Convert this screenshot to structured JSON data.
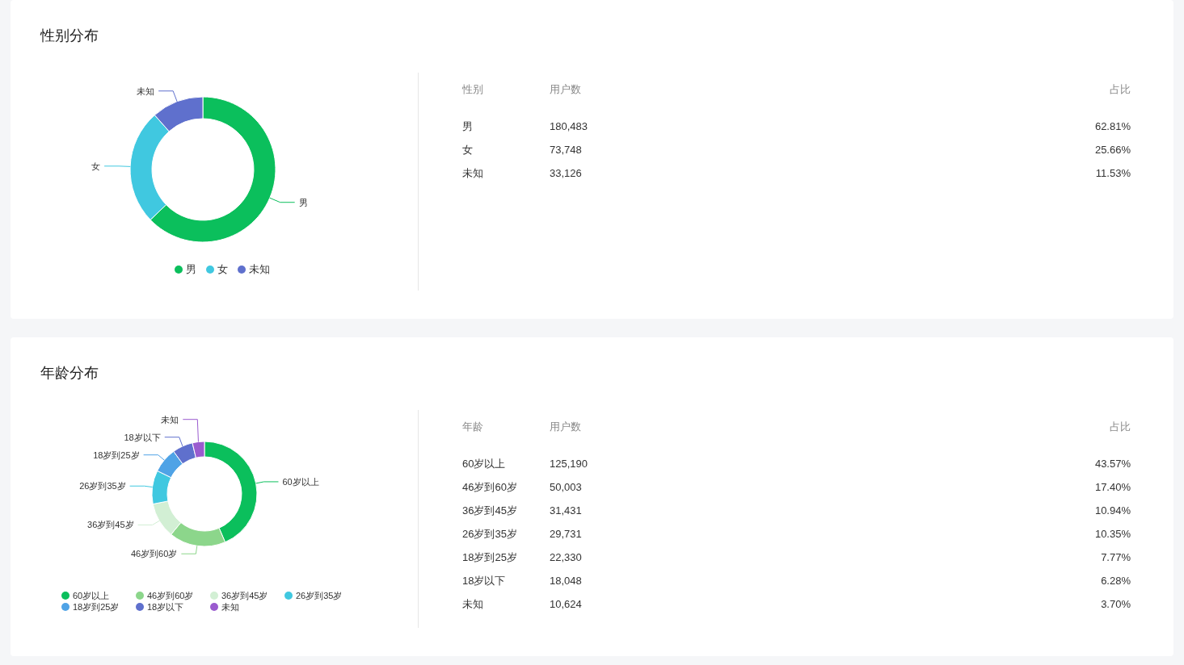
{
  "sections": [
    {
      "title": "性别分布",
      "chart": {
        "chart_data": {
          "type": "donut",
          "categories": [
            "男",
            "女",
            "未知"
          ],
          "values": [
            62.81,
            25.66,
            11.53
          ]
        },
        "legend": [
          {
            "label": "男",
            "color": "#0bbf5c"
          },
          {
            "label": "女",
            "color": "#40c8e0"
          },
          {
            "label": "未知",
            "color": "#5f70cd"
          }
        ]
      },
      "table": {
        "columns": [
          "性别",
          "用户数",
          "占比"
        ],
        "rows": [
          [
            "男",
            "180,483",
            "62.81%"
          ],
          [
            "女",
            "73,748",
            "25.66%"
          ],
          [
            "未知",
            "33,126",
            "11.53%"
          ]
        ]
      }
    },
    {
      "title": "年龄分布",
      "chart": {
        "chart_data": {
          "type": "donut",
          "categories": [
            "60岁以上",
            "46岁到60岁",
            "36岁到45岁",
            "26岁到35岁",
            "18岁到25岁",
            "18岁以下",
            "未知"
          ],
          "values": [
            43.57,
            17.4,
            10.94,
            10.35,
            7.77,
            6.28,
            3.7
          ]
        },
        "legend": [
          {
            "label": "60岁以上",
            "color": "#0bbf5c"
          },
          {
            "label": "46岁到60岁",
            "color": "#8cd68b"
          },
          {
            "label": "36岁到45岁",
            "color": "#d2efd4"
          },
          {
            "label": "26岁到35岁",
            "color": "#40c8e0"
          },
          {
            "label": "18岁到25岁",
            "color": "#4fa3e6"
          },
          {
            "label": "18岁以下",
            "color": "#5f70cd"
          },
          {
            "label": "未知",
            "color": "#9a5bcf"
          }
        ]
      },
      "table": {
        "columns": [
          "年龄",
          "用户数",
          "占比"
        ],
        "rows": [
          [
            "60岁以上",
            "125,190",
            "43.57%"
          ],
          [
            "46岁到60岁",
            "50,003",
            "17.40%"
          ],
          [
            "36岁到45岁",
            "31,431",
            "10.94%"
          ],
          [
            "26岁到35岁",
            "29,731",
            "10.35%"
          ],
          [
            "18岁到25岁",
            "22,330",
            "7.77%"
          ],
          [
            "18岁以下",
            "18,048",
            "6.28%"
          ],
          [
            "未知",
            "10,624",
            "3.70%"
          ]
        ]
      }
    }
  ]
}
